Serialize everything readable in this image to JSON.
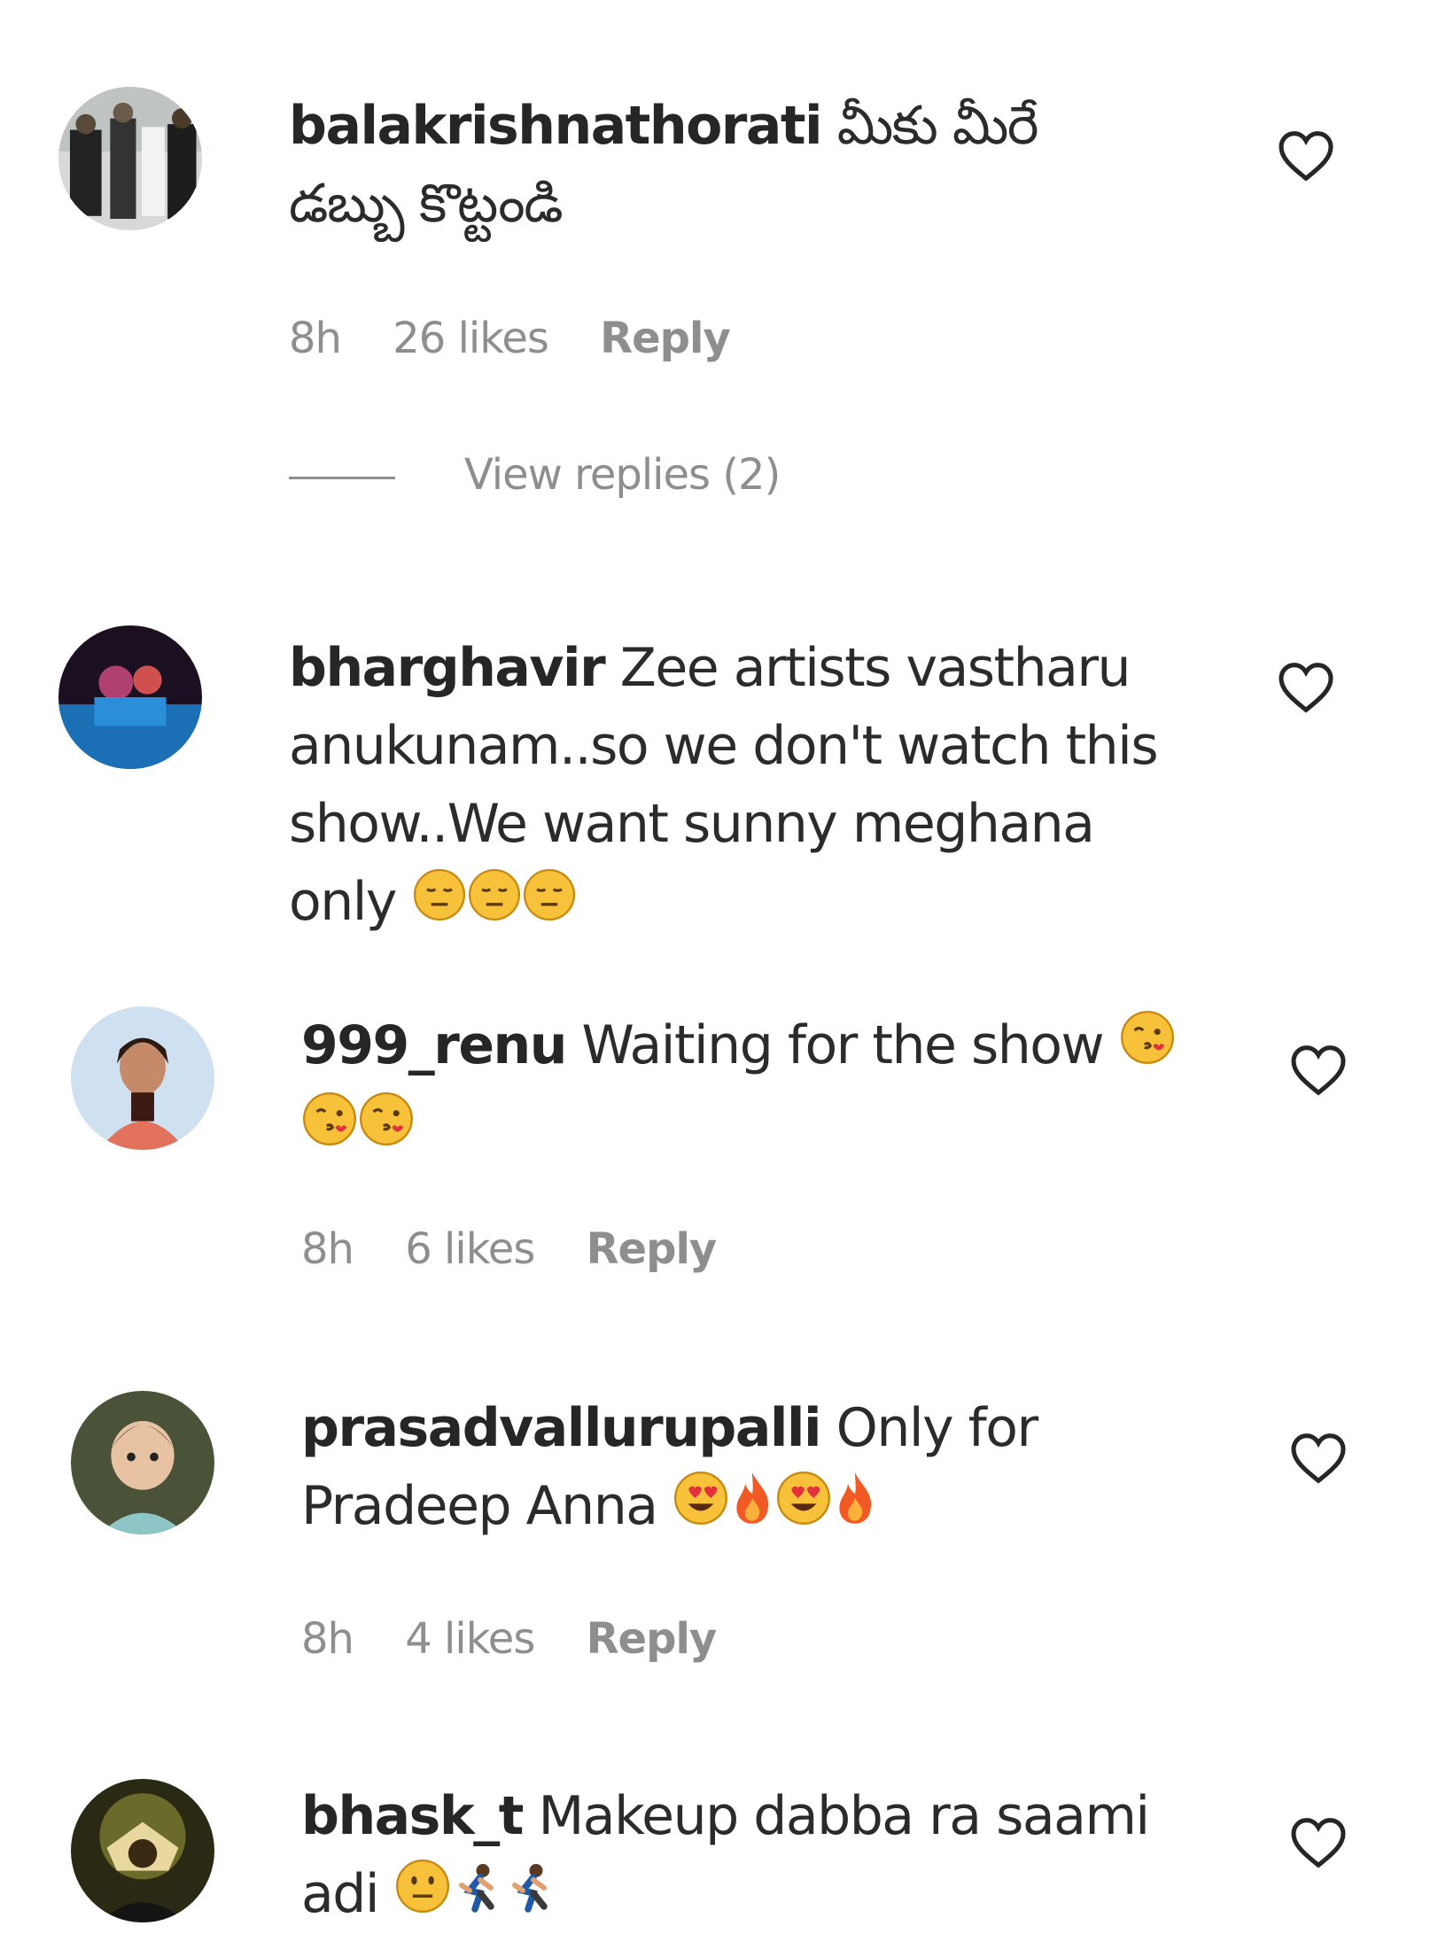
{
  "comments": [
    {
      "username": "balakrishnathorati",
      "text": "మీకు మీరే డబ్బు కొట్టండి",
      "emojis": [],
      "time": "8h",
      "likes": "26 likes",
      "reply_label": "Reply",
      "view_replies": "View replies (2)",
      "avatar_color": "#3a3a3a"
    },
    {
      "username": "bharghavir",
      "text": "Zee artists vastharu anukunam..so we don't watch this show..We want sunny meghana only",
      "emojis": [
        "expressionless-face",
        "expressionless-face",
        "expressionless-face"
      ],
      "avatar_color": "#2b1630"
    },
    {
      "username": "999_renu",
      "text": "Waiting for the show",
      "emojis": [
        "face-blowing-kiss",
        "face-blowing-kiss",
        "face-blowing-kiss"
      ],
      "time": "8h",
      "likes": "6 likes",
      "reply_label": "Reply",
      "avatar_color": "#d4a5a0"
    },
    {
      "username": "prasadvallurupalli",
      "text": "Only for Pradeep Anna",
      "emojis": [
        "heart-eyes",
        "fire",
        "heart-eyes",
        "fire"
      ],
      "time": "8h",
      "likes": "4 likes",
      "reply_label": "Reply",
      "avatar_color": "#6b5a45"
    },
    {
      "username": "bhask_t",
      "text": "Makeup dabba ra saami adi",
      "emojis": [
        "neutral-face",
        "person-running",
        "person-running"
      ],
      "avatar_color": "#5a4a2a"
    }
  ]
}
